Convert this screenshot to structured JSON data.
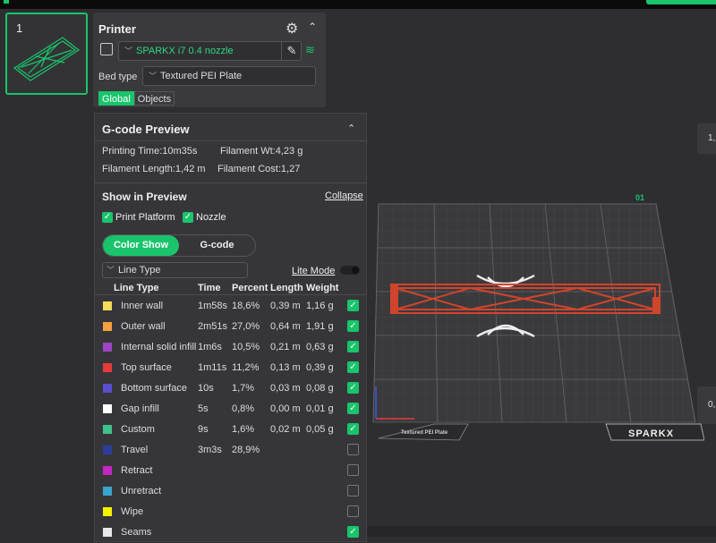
{
  "thumbnail": {
    "number": "1"
  },
  "printer": {
    "title": "Printer",
    "nozzle": "SPARKX i7 0.4 nozzle",
    "bed_type_label": "Bed type",
    "bed_type": "Textured PEI Plate",
    "tabs": [
      "Global",
      "Objects"
    ]
  },
  "gcode": {
    "title": "G-code Preview",
    "printing_time": "Printing Time:10m35s",
    "filament_wt": "Filament Wt:4,23 g",
    "filament_length": "Filament Length:1,42 m",
    "filament_cost": "Filament Cost:1,27",
    "show_in_preview": "Show in Preview",
    "collapse": "Collapse",
    "print_platform": "Print Platform",
    "nozzle": "Nozzle",
    "color_show": "Color Show",
    "gcode_tab": "G-code",
    "line_type_select": "Line Type",
    "lite_mode": "Lite Mode",
    "headers": [
      "Line Type",
      "Time",
      "Percent",
      "Length",
      "Weight"
    ],
    "rows": [
      {
        "name": "Inner wall",
        "time": "1m58s",
        "percent": "18,6%",
        "length": "0,39 m",
        "weight": "1,16 g",
        "color": "#f5dc5a",
        "checked": true
      },
      {
        "name": "Outer wall",
        "time": "2m51s",
        "percent": "27,0%",
        "length": "0,64 m",
        "weight": "1,91 g",
        "color": "#f5a13c",
        "checked": true
      },
      {
        "name": "Internal solid infill",
        "time": "1m6s",
        "percent": "10,5%",
        "length": "0,21 m",
        "weight": "0,63 g",
        "color": "#9d45c7",
        "checked": true
      },
      {
        "name": "Top surface",
        "time": "1m11s",
        "percent": "11,2%",
        "length": "0,13 m",
        "weight": "0,39 g",
        "color": "#e53b3b",
        "checked": true
      },
      {
        "name": "Bottom surface",
        "time": "10s",
        "percent": "1,7%",
        "length": "0,03 m",
        "weight": "0,08 g",
        "color": "#5a4fcf",
        "checked": true
      },
      {
        "name": "Gap infill",
        "time": "5s",
        "percent": "0,8%",
        "length": "0,00 m",
        "weight": "0,01 g",
        "color": "#ffffff",
        "checked": true
      },
      {
        "name": "Custom",
        "time": "9s",
        "percent": "1,6%",
        "length": "0,02 m",
        "weight": "0,05 g",
        "color": "#3ec18a",
        "checked": true
      },
      {
        "name": "Travel",
        "time": "3m3s",
        "percent": "28,9%",
        "length": "",
        "weight": "",
        "color": "#2e3d9a",
        "checked": false
      },
      {
        "name": "Retract",
        "time": "",
        "percent": "",
        "length": "",
        "weight": "",
        "color": "#c326c3",
        "checked": false
      },
      {
        "name": "Unretract",
        "time": "",
        "percent": "",
        "length": "",
        "weight": "",
        "color": "#3aa5cc",
        "checked": false
      },
      {
        "name": "Wipe",
        "time": "",
        "percent": "",
        "length": "",
        "weight": "",
        "color": "#f5f200",
        "checked": false
      },
      {
        "name": "Seams",
        "time": "",
        "percent": "",
        "length": "",
        "weight": "",
        "color": "#e8e8e8",
        "checked": true
      }
    ]
  },
  "viewport": {
    "plate_label": "01",
    "plate_brand": "SPARKX",
    "plate_type": "Textured PEI Plate",
    "right_tab_top": "1,",
    "right_tab_bottom": "0,"
  },
  "colors": {
    "accent": "#19c46b",
    "panel": "#36363a",
    "background": "#2e2e31"
  }
}
